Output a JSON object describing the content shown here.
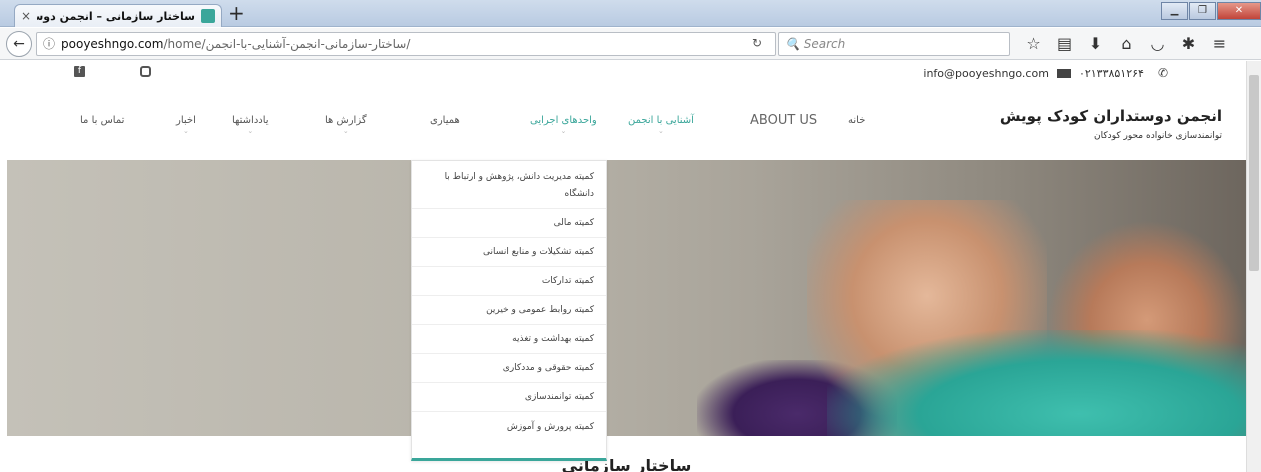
{
  "browser": {
    "tab_title": "ساختار سازمانی – انجمن دوستدا",
    "tab_close": "×",
    "new_tab": "+",
    "url_host": "pooyeshngo.com",
    "url_path": "/home/ساختار-سازمانی-انجمن-آشنایی-با-انجمن/",
    "search_placeholder": "Search",
    "icons": [
      "star-icon",
      "library-icon",
      "download-icon",
      "home-icon",
      "pocket-icon",
      "extension-icon",
      "menu-icon"
    ]
  },
  "topbar": {
    "email": "info@pooyeshngo.com",
    "phone": "۰۲۱۳۳۸۵۱۲۶۴"
  },
  "brand": {
    "title": "انجمن دوستداران کودک پویش",
    "subtitle": "توانمندسازی خانواده محور کودکان"
  },
  "menu": {
    "items": [
      {
        "label": "خانه"
      },
      {
        "label": "ABOUT US"
      },
      {
        "label": "آشنایی با انجمن"
      },
      {
        "label": "واحدهای اجرایی"
      },
      {
        "label": "همیاری"
      },
      {
        "label": "گزارش ها"
      },
      {
        "label": "یادداشتها"
      },
      {
        "label": "اخبار"
      },
      {
        "label": "تماس با ما"
      }
    ]
  },
  "dropdown": {
    "items": [
      "کمیته مدیریت دانش، پژوهش و ارتباط با دانشگاه",
      "کمیته مالی",
      "کمیته تشکیلات و منابع انسانی",
      "کمیته تدارکات",
      "کمیته روابط عمومی و خیرین",
      "کمیته بهداشت و تغذیه",
      "کمیته حقوقی و مددکاری",
      "کمیته توانمندسازی",
      "کمیته پرورش و آموزش"
    ]
  },
  "content": {
    "title": "ساختار سازمانی"
  },
  "colors": {
    "accent": "#3aa69a"
  }
}
